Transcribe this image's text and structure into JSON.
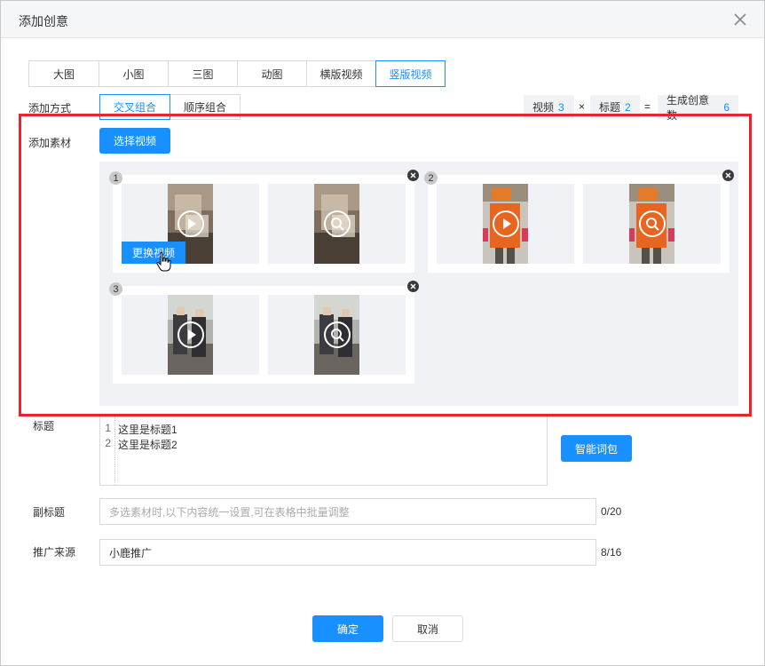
{
  "dialog": {
    "title": "添加创意"
  },
  "tabs": [
    {
      "label": "大图"
    },
    {
      "label": "小图"
    },
    {
      "label": "三图"
    },
    {
      "label": "动图"
    },
    {
      "label": "横版视频"
    },
    {
      "label": "竖版视频",
      "active": true
    }
  ],
  "add_method": {
    "label": "添加方式",
    "options": [
      {
        "label": "交叉组合",
        "active": true
      },
      {
        "label": "顺序组合"
      }
    ]
  },
  "summary": {
    "video_label": "视频",
    "video_count": "3",
    "times": "×",
    "title_label": "标题",
    "title_count": "2",
    "equals": "=",
    "result_label": "生成创意数",
    "result_count": "6"
  },
  "material": {
    "label": "添加素材",
    "select_button": "选择视频",
    "replace_button": "更换视频",
    "groups": [
      {
        "index": "1",
        "theme": "car"
      },
      {
        "index": "2",
        "theme": "orange"
      },
      {
        "index": "3",
        "theme": "street"
      }
    ]
  },
  "titles": {
    "label": "标题",
    "lines": [
      {
        "n": "1",
        "text": "这里是标题1"
      },
      {
        "n": "2",
        "text": "这里是标题2"
      }
    ],
    "smart_button": "智能词包"
  },
  "subtitle": {
    "label": "副标题",
    "placeholder": "多选素材时,以下内容统一设置,可在表格中批量调整",
    "count": "0/20"
  },
  "source": {
    "label": "推广来源",
    "value": "小鹿推广",
    "count": "8/16"
  },
  "footer": {
    "ok": "确定",
    "cancel": "取消"
  },
  "colors": {
    "accent": "#1890ff",
    "highlight": "#e8242c"
  },
  "icons": {
    "close": "close-icon",
    "play": "play-icon",
    "search": "search-icon",
    "delete": "delete-icon"
  }
}
